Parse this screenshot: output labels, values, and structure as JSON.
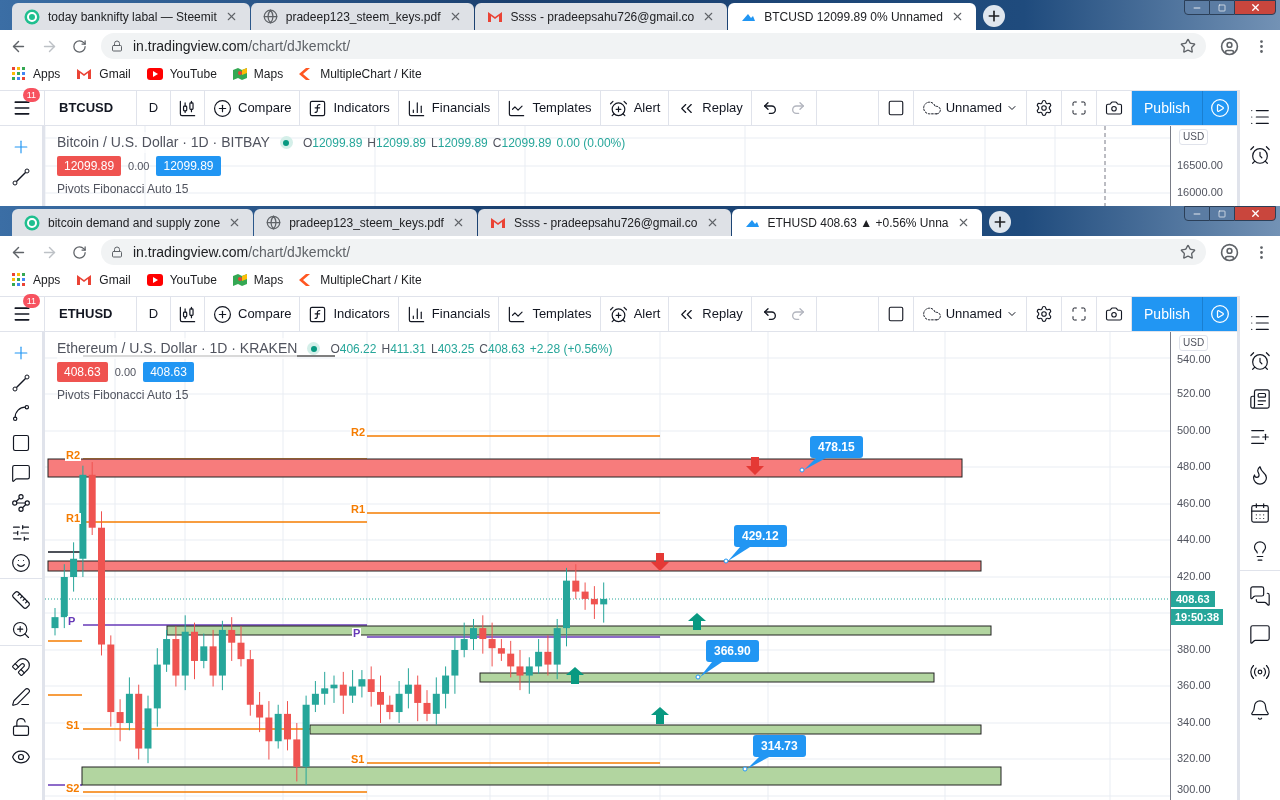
{
  "windows": [
    {
      "tabs": [
        {
          "title": "today banknifty labal — Steemit",
          "kind": "steemit",
          "selected": false
        },
        {
          "title": "pradeep123_steem_keys.pdf",
          "kind": "globe",
          "selected": false
        },
        {
          "title": "Ssss - pradeepsahu726@gmail.co",
          "kind": "gmail",
          "selected": false
        },
        {
          "title": "BTCUSD 12099.89 0% Unnamed",
          "kind": "tradingview",
          "selected": true
        }
      ],
      "address": {
        "host": "in.tradingview.com",
        "path": "/chart/dJkemckt/"
      },
      "bookmarks": [
        {
          "label": "Apps",
          "kind": "apps"
        },
        {
          "label": "Gmail",
          "kind": "gmail"
        },
        {
          "label": "YouTube",
          "kind": "youtube"
        },
        {
          "label": "Maps",
          "kind": "maps"
        },
        {
          "label": "MultipleChart / Kite",
          "kind": "kite"
        }
      ],
      "toolbar": {
        "alert_count": "11",
        "symbol": "BTCUSD",
        "interval": "D",
        "items": [
          {
            "label": "Compare",
            "kind": "compare"
          },
          {
            "label": "Indicators",
            "kind": "indicators"
          },
          {
            "label": "Financials",
            "kind": "financials"
          },
          {
            "label": "Templates",
            "kind": "templates"
          },
          {
            "label": "Alert",
            "kind": "alert"
          },
          {
            "label": "Replay",
            "kind": "replay"
          }
        ],
        "layout": "Unnamed",
        "publish": "Publish"
      },
      "chart": {
        "title": "Bitcoin / U.S. Dollar · 1D · BITBAY",
        "ohlc": [
          {
            "key": "O",
            "value": "12099.89"
          },
          {
            "key": "H",
            "value": "12099.89"
          },
          {
            "key": "L",
            "value": "12099.89"
          },
          {
            "key": "C",
            "value": "12099.89"
          }
        ],
        "change": "0.00 (0.00%)",
        "bid": "12099.89",
        "spread": "0.00",
        "ask": "12099.89",
        "indicator": "Pivots Fibonacci Auto 15",
        "currency": "USD",
        "axis_ticks": [
          "16500.00",
          "16000.00"
        ]
      }
    },
    {
      "tabs": [
        {
          "title": "bitcoin demand and supply zone",
          "kind": "steemit",
          "selected": false
        },
        {
          "title": "pradeep123_steem_keys.pdf",
          "kind": "globe",
          "selected": false
        },
        {
          "title": "Ssss - pradeepsahu726@gmail.co",
          "kind": "gmail",
          "selected": false
        },
        {
          "title": "ETHUSD 408.63 ▲ +0.56% Unna",
          "kind": "tradingview",
          "selected": true
        }
      ],
      "address": {
        "host": "in.tradingview.com",
        "path": "/chart/dJkemckt/"
      },
      "bookmarks": [
        {
          "label": "Apps",
          "kind": "apps"
        },
        {
          "label": "Gmail",
          "kind": "gmail"
        },
        {
          "label": "YouTube",
          "kind": "youtube"
        },
        {
          "label": "Maps",
          "kind": "maps"
        },
        {
          "label": "MultipleChart / Kite",
          "kind": "kite"
        }
      ],
      "toolbar": {
        "alert_count": "11",
        "symbol": "ETHUSD",
        "interval": "D",
        "items": [
          {
            "label": "Compare",
            "kind": "compare"
          },
          {
            "label": "Indicators",
            "kind": "indicators"
          },
          {
            "label": "Financials",
            "kind": "financials"
          },
          {
            "label": "Templates",
            "kind": "templates"
          },
          {
            "label": "Alert",
            "kind": "alert"
          },
          {
            "label": "Replay",
            "kind": "replay"
          }
        ],
        "layout": "Unnamed",
        "publish": "Publish"
      },
      "chart": {
        "title": "Ethereum / U.S. Dollar · 1D · KRAKEN",
        "ohlc": [
          {
            "key": "O",
            "value": "406.22"
          },
          {
            "key": "H",
            "value": "411.31"
          },
          {
            "key": "L",
            "value": "403.25"
          },
          {
            "key": "C",
            "value": "408.63"
          }
        ],
        "change": "+2.28 (+0.56%)",
        "bid": "408.63",
        "spread": "0.00",
        "ask": "408.63",
        "indicator": "Pivots Fibonacci Auto 15",
        "currency": "USD",
        "axis_ticks": [
          "540.00",
          "520.00",
          "500.00",
          "480.00",
          "460.00",
          "440.00",
          "420.00",
          "380.00",
          "360.00",
          "340.00",
          "320.00",
          "300.00"
        ],
        "last_price": "408.63",
        "countdown": "19:50:38",
        "pivot_labels": [
          {
            "label": "R2",
            "color": "#f57c00"
          },
          {
            "label": "R1",
            "color": "#f57c00"
          },
          {
            "label": "P",
            "color": "#673ab7"
          },
          {
            "label": "S1",
            "color": "#f57c00"
          },
          {
            "label": "S2",
            "color": "#f57c00"
          },
          {
            "label": "R2",
            "color": "#f57c00"
          },
          {
            "label": "R1",
            "color": "#f57c00"
          },
          {
            "label": "P",
            "color": "#673ab7"
          },
          {
            "label": "S1",
            "color": "#f57c00"
          }
        ],
        "zone_labels": [
          "478.15",
          "429.12",
          "366.90",
          "314.73"
        ]
      }
    }
  ]
}
